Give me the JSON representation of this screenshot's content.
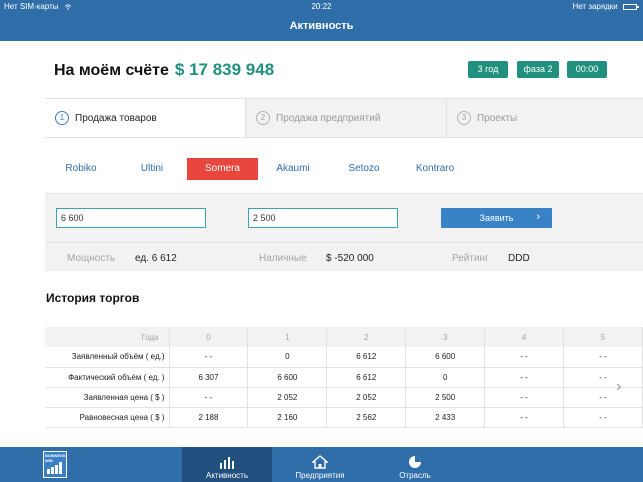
{
  "status_bar": {
    "carrier": "Нет SIM-карты",
    "time": "20:22",
    "charging": "Нет зарядки"
  },
  "nav": {
    "title": "Активность"
  },
  "account": {
    "label": "На моём счёте",
    "amount": "$ 17 839 948"
  },
  "chips": [
    "3 год",
    "фаза 2",
    "00:00"
  ],
  "steps": [
    {
      "num": "1",
      "label": "Продажа товаров",
      "active": true
    },
    {
      "num": "2",
      "label": "Продажа предприятий",
      "active": false
    },
    {
      "num": "3",
      "label": "Проекты",
      "active": false
    }
  ],
  "companies": {
    "items": [
      "Robiko",
      "Ultini",
      "Somera",
      "Akaumi",
      "Setozo",
      "Kontraro"
    ],
    "selected": "Somera"
  },
  "form": {
    "volume_value": "6 600",
    "price_value": "2 500",
    "submit_label": "Заявить",
    "submit_arrow": "›",
    "power_label": "Мощность",
    "power_value": "ед. 6 612",
    "cash_label": "Наличные",
    "cash_value": "$ -520 000",
    "rating_label": "Рейтинг",
    "rating_value": "DDD"
  },
  "history": {
    "title": "История торгов",
    "header_label": "Года",
    "years": [
      "0",
      "1",
      "2",
      "3",
      "4",
      "5"
    ],
    "rows": [
      {
        "label": "Заявленный объём ( ед.)",
        "cells": [
          "- -",
          "0",
          "6 612",
          "6 600",
          "- -",
          "- -"
        ]
      },
      {
        "label": "Фактический объём ( ед. )",
        "cells": [
          "6 307",
          "6 600",
          "6 612",
          "0",
          "- -",
          "- -"
        ]
      },
      {
        "label": "Заявленная цена ( $ )",
        "cells": [
          "- -",
          "2 052",
          "2 052",
          "2 500",
          "- -",
          "- -"
        ]
      },
      {
        "label": "Равновесная цена ( $ )",
        "cells": [
          "2 188",
          "2 160",
          "2 562",
          "2 433",
          "- -",
          "- -"
        ]
      }
    ],
    "next_arrow": "›"
  },
  "logo": {
    "text": "BUSINESS WIN"
  },
  "tabbar": {
    "items": [
      {
        "label": "Активность",
        "icon": "bar-chart-icon",
        "active": true
      },
      {
        "label": "Предприятия",
        "icon": "house-icon",
        "active": false
      },
      {
        "label": "Отрасль",
        "icon": "pie-chart-icon",
        "active": false
      }
    ]
  },
  "colors": {
    "primary": "#2f6ea8",
    "accent_green": "#21907f",
    "selected_red": "#e8453c",
    "button_blue": "#3a82c6"
  }
}
